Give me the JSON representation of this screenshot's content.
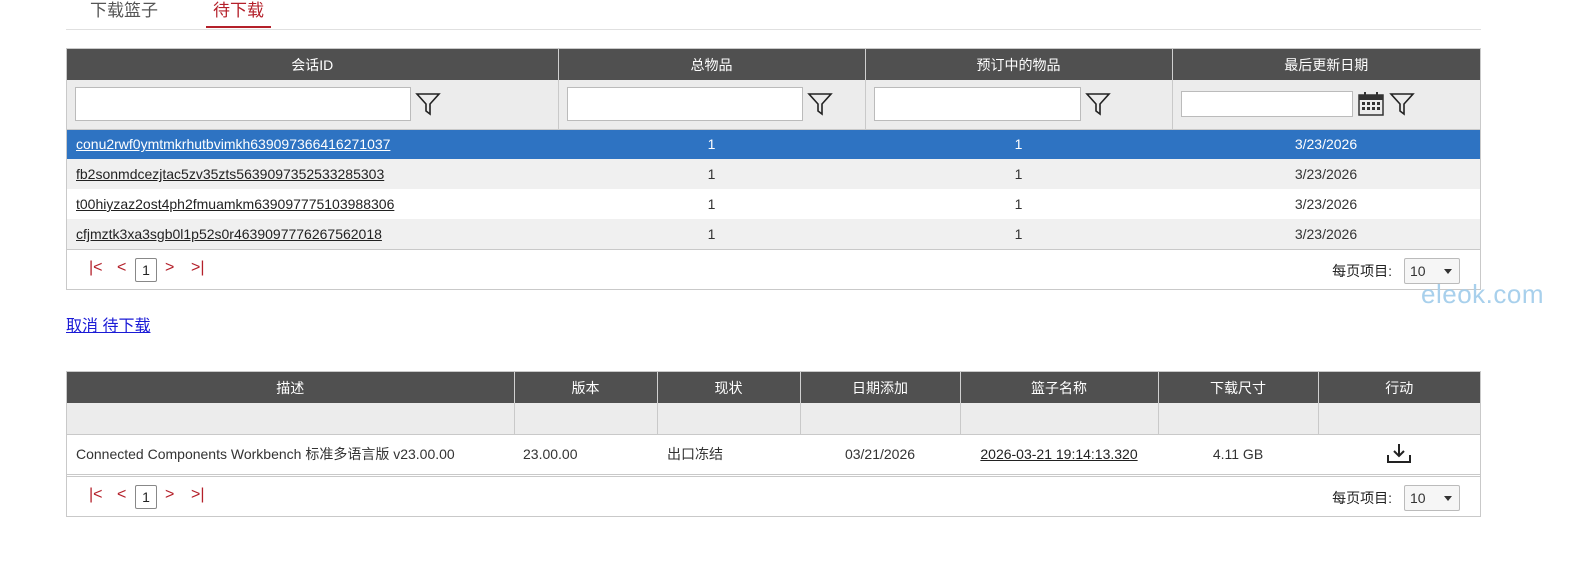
{
  "tabs": [
    {
      "label": "下载篮子"
    },
    {
      "label": "待下载"
    }
  ],
  "sessions_grid": {
    "headers": [
      "会话ID",
      "总物品",
      "预订中的物品",
      "最后更新日期"
    ],
    "rows": [
      {
        "session_id": "conu2rwf0ymtmkrhutbvimkh639097366416271037",
        "total": "1",
        "reserved": "1",
        "updated": "3/23/2026"
      },
      {
        "session_id": "fb2sonmdcezjtac5zv35zts563909735253328530​3",
        "total": "1",
        "reserved": "1",
        "updated": "3/23/2026"
      },
      {
        "session_id": "t00hiyzaz2ost4ph2fmuamkm639097775103988306",
        "total": "1",
        "reserved": "1",
        "updated": "3/23/2026"
      },
      {
        "session_id": "cfjmztk3xa3sgb0l1p52s0r4639097776267562018",
        "total": "1",
        "reserved": "1",
        "updated": "3/23/2026"
      }
    ],
    "pager": {
      "page": "1",
      "per_page_label": "每页项目:",
      "per_page": "10"
    }
  },
  "cancel_link": "取消 待下载",
  "watermark": "eleok.com",
  "items_grid": {
    "headers": [
      "描述",
      "版本",
      "现状",
      "日期添加",
      "篮子名称",
      "下载尺寸",
      "行动"
    ],
    "rows": [
      {
        "description": "Connected Components Workbench 标准多语言版 v23.00.00",
        "version": "23.00.00",
        "status": "出口冻结",
        "date_added": "03/21/2026",
        "basket": "2026-03-21 19:14:13.320",
        "size": "4.11 GB",
        "action_icon": "download-icon"
      }
    ],
    "pager": {
      "page": "1",
      "per_page_label": "每页项目:",
      "per_page": "10"
    }
  }
}
